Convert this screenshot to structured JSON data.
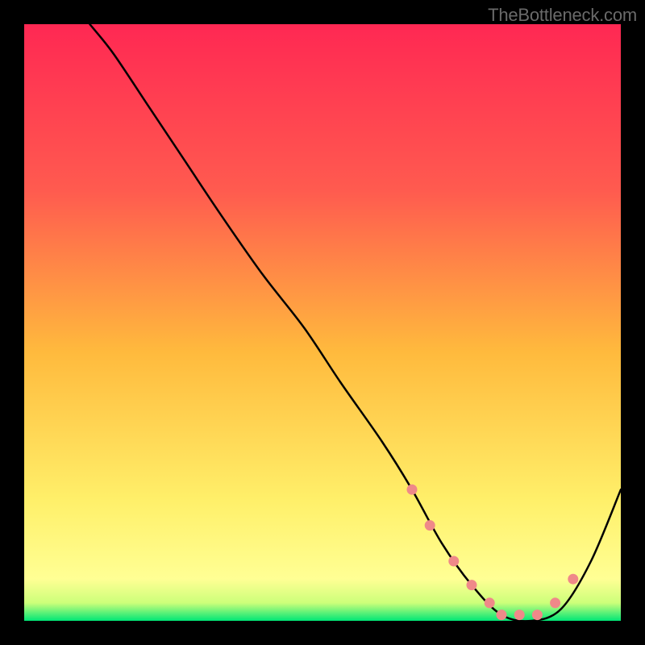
{
  "attribution": "TheBottleneck.com",
  "chart_data": {
    "type": "line",
    "title": "",
    "xlabel": "",
    "ylabel": "",
    "xlim": [
      0,
      100
    ],
    "ylim": [
      0,
      100
    ],
    "background_gradient": {
      "top": "#ff2853",
      "bottom_mid": "#ffff7a",
      "bottom": "#00e676"
    },
    "series": [
      {
        "name": "bottleneck-curve",
        "color": "#000000",
        "x": [
          11,
          15,
          21,
          27,
          33,
          40,
          47,
          53,
          60,
          65,
          70,
          75,
          80,
          85,
          90,
          95,
          100
        ],
        "values": [
          100,
          95,
          86,
          77,
          68,
          58,
          49,
          40,
          30,
          22,
          13,
          6,
          1,
          0,
          2,
          10,
          22
        ]
      }
    ],
    "markers": {
      "name": "valley-markers",
      "color": "#ef8989",
      "x": [
        65,
        68,
        72,
        75,
        78,
        80,
        83,
        86,
        89,
        92
      ],
      "values": [
        22,
        16,
        10,
        6,
        3,
        1,
        1,
        1,
        3,
        7
      ]
    }
  }
}
